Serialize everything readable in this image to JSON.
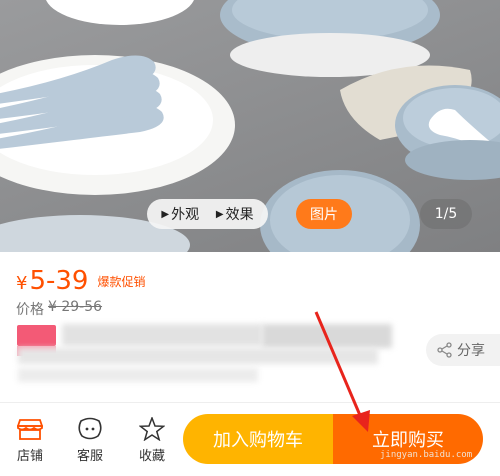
{
  "gallery": {
    "tabs": [
      {
        "label": "外观"
      },
      {
        "label": "效果"
      }
    ],
    "image_tab": "图片",
    "counter": "1/5"
  },
  "price": {
    "symbol": "¥",
    "value": "5-39",
    "promo_badge": "爆款促销",
    "original_label": "价格",
    "original_value": "¥ 29-56"
  },
  "share": {
    "label": "分享"
  },
  "toolbar": {
    "store": "店铺",
    "service": "客服",
    "favorite": "收藏",
    "add_to_cart": "加入购物车",
    "buy_now": "立即购买"
  },
  "watermark": "jingyan.baidu.com",
  "colors": {
    "accent": "#ff5000",
    "cart_button": "#ffb400",
    "buy_button": "#ff6a00",
    "annotation_arrow": "#e8241c"
  }
}
